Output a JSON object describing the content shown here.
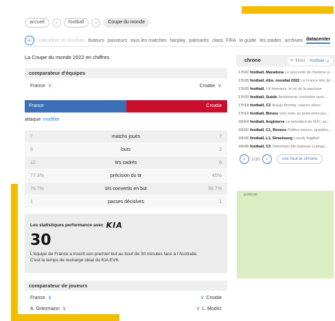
{
  "breadcrumb": [
    "accueil",
    "football",
    "Coupe du monde"
  ],
  "nav": {
    "items": [
      "mondial",
      "calendrier et résultats",
      "buteurs",
      "passeurs",
      "tous les matches",
      "fairplay",
      "palmarès",
      "class. FIFA",
      "le guide",
      "les stades",
      "archives",
      "datacenter"
    ],
    "active": "datacenter"
  },
  "page_title": "La Coupe du monde 2022 en chiffres",
  "comparator_teams": {
    "title": "comparateur d'équipes",
    "team_left": "France",
    "team_right": "Croatie",
    "color_left": "#3b6fb6",
    "color_right": "#c8102e"
  },
  "attack": {
    "label": "attaque",
    "link": "modifier"
  },
  "stats": [
    {
      "left": "7",
      "label": "matchs joués",
      "right": "7"
    },
    {
      "left": "6",
      "label": "buts",
      "right": "3"
    },
    {
      "left": "12",
      "label": "tirs cadrés",
      "right": "6"
    },
    {
      "left": "77.3%",
      "label": "précision du tir",
      "right": "40%"
    },
    {
      "left": "76.7%",
      "label": "tirs convertis en but",
      "right": "36.7%"
    },
    {
      "left": "1",
      "label": "passes décisives",
      "right": "1"
    }
  ],
  "kia": {
    "heading": "Les statistiques performance avec",
    "logo": "KIA",
    "number": "30",
    "text": "L'équipe de France a inscrit son premier but au bout de 30 minutes face à l'Australie. C'est le temps de recharge idéal du KIA EV6."
  },
  "comparator_players": {
    "title": "comparateur de joueurs",
    "team_left": "France",
    "team_right": "Croatie",
    "player_left": "A. Griezmann",
    "player_right": "L. Modric"
  },
  "chrono": {
    "title": "chrono",
    "filter_prefix": "filtrer :",
    "filter_value": "football",
    "items": [
      {
        "time": "17h32",
        "tag": "football, Maradona",
        "text": "Le précocité de l'homme a..."
      },
      {
        "time": "17h28",
        "tag": "football, élim. mondial 2022",
        "text": "La France tête de..."
      },
      {
        "time": "17h26",
        "tag": "football,",
        "text": "Uli Hoeness, le roi de la saucisse"
      },
      {
        "time": "17h20",
        "tag": "football, Suède",
        "text": "Ibrahimovic s'entraîne avec..."
      },
      {
        "time": "17h18",
        "tag": "football, C3",
        "text": "Araujo Bomba, valeurs sûres"
      },
      {
        "time": "17h16",
        "tag": "football, Bleues",
        "text": "Une mise au point entre jou..."
      },
      {
        "time": "16h54",
        "tag": "football, Angleterre",
        "text": "Le président de l'EFL va..."
      },
      {
        "time": "16h50",
        "tag": "football, C1, Rennes",
        "text": "Petites erreurs, grandes..."
      },
      {
        "time": "16h56",
        "tag": "football, L1, Strasbourg",
        "text": "Lourdy fragilisé"
      },
      {
        "time": "16h49",
        "tag": "football, C3",
        "text": "Tottenham fait exploser Ludogo..."
      }
    ],
    "pager": "1/10",
    "see_all": "voir tout le chrono"
  },
  "ad": {
    "label": "publicité",
    "color": "#dbedc2"
  },
  "accent_color": "#3b7fd9"
}
